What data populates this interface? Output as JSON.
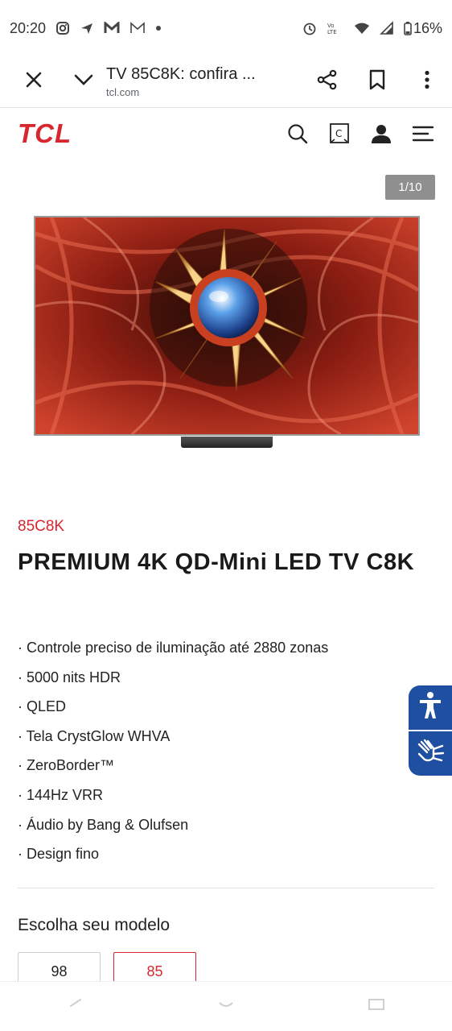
{
  "status_bar": {
    "time": "20:20",
    "left_icons": [
      "instagram-icon",
      "send-icon",
      "gmail-icon",
      "gmail-outline-icon",
      "dot-icon"
    ],
    "right_icons": [
      "alarm-icon",
      "volte-icon",
      "wifi-icon",
      "signal-icon"
    ],
    "battery": "16%"
  },
  "browser": {
    "title": "TV 85C8K: confira ...",
    "url": "tcl.com"
  },
  "site": {
    "logo": "TCL",
    "brand_color": "#d7262e"
  },
  "gallery": {
    "counter": "1/10"
  },
  "product": {
    "code": "85C8K",
    "title": "PREMIUM 4K QD-Mini LED TV C8K",
    "features": [
      "· Controle preciso de iluminação até 2880 zonas",
      "· 5000 nits HDR",
      "· QLED",
      "· Tela CrystGlow WHVA",
      "· ZeroBorder™",
      "· 144Hz VRR",
      "· Áudio by Bang & Olufsen",
      "· Design fino"
    ]
  },
  "model_selector": {
    "label": "Escolha seu modelo",
    "options": [
      "98",
      "85"
    ],
    "selected": "85"
  },
  "accessibility": {
    "accent": "#1f4fa0"
  }
}
